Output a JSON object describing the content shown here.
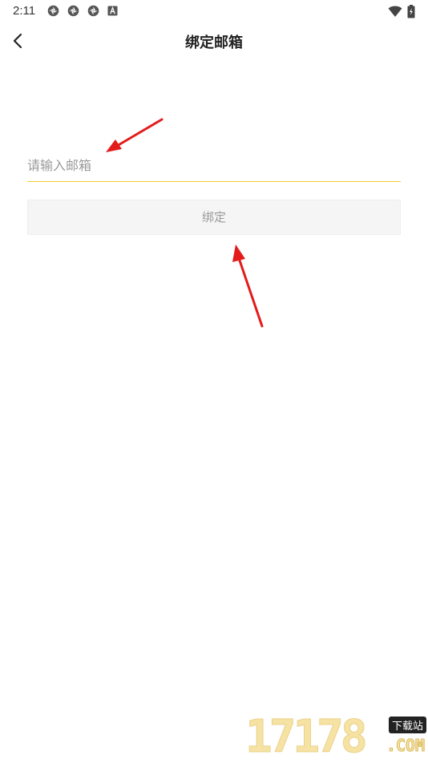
{
  "status_bar": {
    "time": "2:11"
  },
  "header": {
    "title": "绑定邮箱",
    "back_icon": "chevron-left-icon"
  },
  "form": {
    "email_placeholder": "请输入邮箱",
    "email_value": "",
    "bind_label": "绑定"
  },
  "watermark": {
    "digits": "17178",
    "tag": "下载站",
    "domain": ".COM"
  },
  "colors": {
    "input_underline": "#f2cf3a",
    "button_bg": "#f5f5f5",
    "annotation_arrow": "#e31b1b"
  }
}
